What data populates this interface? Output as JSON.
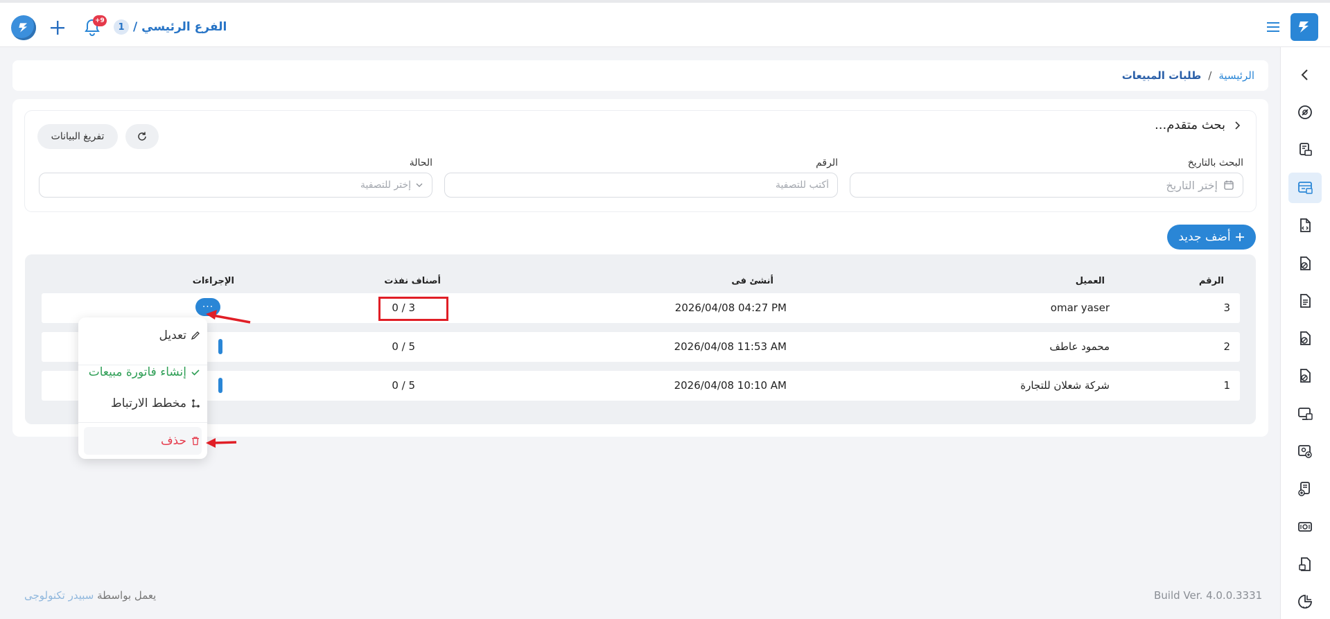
{
  "topbar": {
    "notification_badge": "+9",
    "branch_number": "1",
    "branch_label": "الفرع الرئيسي /"
  },
  "breadcrumb": {
    "home": "الرئيسية",
    "separator": "/",
    "current": "طلبات المبيعات"
  },
  "filters": {
    "title": "بحث متقدم...",
    "reset_label": "تفريغ البيانات",
    "date_label": "البحث بالتاريخ",
    "date_placeholder": "إختر التاريخ",
    "number_label": "الرقم",
    "number_placeholder": "أكتب للتصفية",
    "status_label": "الحالة",
    "status_placeholder": "إختر للتصفية"
  },
  "add_button_label": "أضف جديد",
  "table": {
    "headers": {
      "number": "الرقم",
      "customer": "العميل",
      "created_at": "أنشئ فى",
      "items_done": "أصناف نفذت",
      "actions": "الإجراءات"
    },
    "rows": [
      {
        "number": "3",
        "customer": "omar yaser",
        "created_at": "2026/04/08 04:27 PM",
        "items_done": "0 / 3"
      },
      {
        "number": "2",
        "customer": "محمود عاطف",
        "created_at": "2026/04/08 11:53 AM",
        "items_done": "0 / 5"
      },
      {
        "number": "1",
        "customer": "شركة شعلان للتجارة",
        "created_at": "2026/04/08 10:10 AM",
        "items_done": "0 / 5"
      }
    ],
    "actions_button": "···"
  },
  "actions_menu": {
    "edit": "تعديل",
    "create_invoice": "إنشاء فاتورة مبيعات",
    "link_diagram": "مخطط الارتباط",
    "delete": "حذف"
  },
  "footer": {
    "powered_prefix": "يعمل بواسطة",
    "powered_brand": "سبيدر تكنولوجى",
    "build_version": "Build Ver. 4.0.0.3331"
  },
  "colors": {
    "primary": "#2a86d6",
    "success": "#2e9e55",
    "danger": "#e5394a",
    "annotation": "#e01e26"
  }
}
